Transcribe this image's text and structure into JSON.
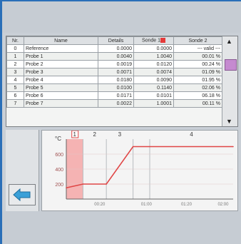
{
  "table": {
    "columns": [
      "Nr.",
      "Name",
      "Details",
      "Sonde 1",
      "Sonde 2"
    ],
    "sonde1_badge": "1",
    "rows": [
      {
        "nr": "0",
        "name": "Reference",
        "details": "0.0000",
        "v1": "0.0000",
        "v2": "--- valid ---"
      },
      {
        "nr": "1",
        "name": "Probe 1",
        "details": "0.0040",
        "v1": "1.0040",
        "v2": "00.01 %"
      },
      {
        "nr": "2",
        "name": "Probe 2",
        "details": "0.0019",
        "v1": "0.0120",
        "v2": "00.24 %"
      },
      {
        "nr": "3",
        "name": "Probe 3",
        "details": "0.0071",
        "v1": "0.0074",
        "v2": "01.09 %"
      },
      {
        "nr": "4",
        "name": "Probe 4",
        "details": "0.0180",
        "v1": "0.0090",
        "v2": "01.95 %"
      },
      {
        "nr": "5",
        "name": "Probe 5",
        "details": "0.0100",
        "v1": "0.1140",
        "v2": "02.06 %"
      },
      {
        "nr": "6",
        "name": "Probe 6",
        "details": "0.0171",
        "v1": "0.0101",
        "v2": "06.18 %"
      },
      {
        "nr": "7",
        "name": "Probe 7",
        "details": "0.0022",
        "v1": "1.0001",
        "v2": "00.11 %"
      }
    ]
  },
  "chart_data": {
    "type": "line",
    "ylabel": "°C",
    "y_ticks": [
      "600",
      "400",
      "200"
    ],
    "x_ticks": [
      "00:20",
      "01:00",
      "01:20",
      "02:00"
    ],
    "segment_labels": [
      "1",
      "2",
      "3",
      "4"
    ],
    "highlighted_segment": "1",
    "x": [
      0,
      10,
      24,
      40,
      50,
      100
    ],
    "y": [
      150,
      200,
      200,
      700,
      700,
      700
    ],
    "xlim": [
      0,
      100
    ],
    "ylim": [
      0,
      800
    ],
    "line_color": "#e04646",
    "highlight_color": "#f5a3a3"
  },
  "icons": {
    "back": "arrow-left-icon",
    "scroll_up": "triangle-up-icon",
    "scroll_down": "triangle-down-icon"
  },
  "colors": {
    "accent_blue": "#2a6fb8",
    "back_arrow": "#3aa0d8",
    "thumb": "#c58ad0"
  }
}
